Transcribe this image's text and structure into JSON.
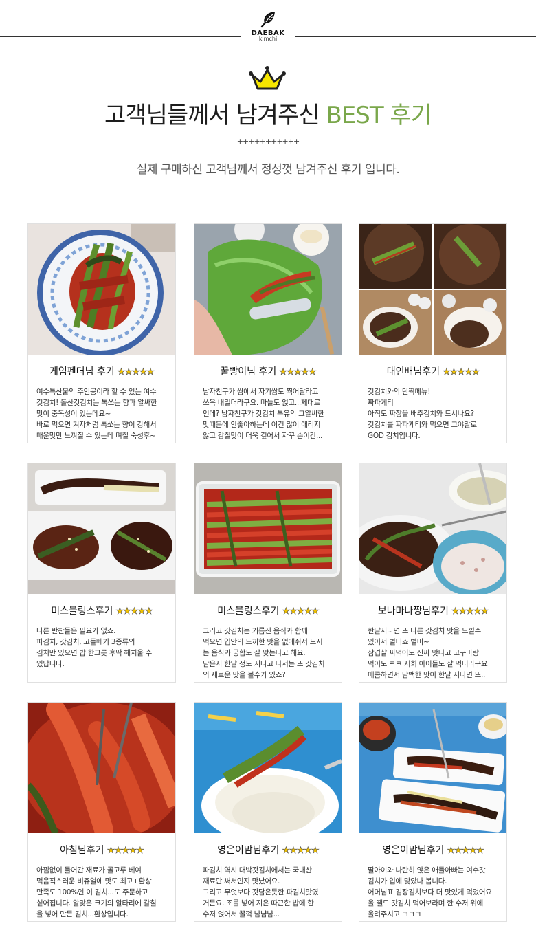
{
  "brand": {
    "name": "DAEBAK",
    "sub": "kimchi",
    "logo_icon": "leaf-icon"
  },
  "header": {
    "crown_icon": "crown-icon",
    "title_main": "고객님들께서 남겨주신 ",
    "title_accent": "BEST 후기",
    "divider": "+++++++++++",
    "subtitle": "실제 구매하신 고객님께서 정성껏 남겨주신 후기 입니다."
  },
  "colors": {
    "accent": "#7aa74b",
    "star": "#f2c200",
    "kimchi_red": "#c8301c",
    "leaf_green": "#4f8a2a"
  },
  "reviews": [
    {
      "title": "게임펜더님 후기",
      "stars": "★★★★★",
      "lines": [
        "여수특산물의 주인공이라 할 수 있는 여수",
        "갓김치! 돌산갓김치는 톡쏘는 향과 알싸한",
        "맛이 중독성이 있는데요~",
        "바로 먹으면 겨자처럼 톡쏘는 향이 강해서",
        "매운맛만 느껴질 수 있는데 며칠 숙성후~"
      ]
    },
    {
      "title": "꿀빵이님 후기",
      "stars": "★★★★★",
      "lines": [
        "남자친구가 쌈에서 자기쌈도 찍어달라고",
        "쓰윽 내밀더라구요. 마늘도 얹고...제대로",
        "인데? 남자친구가 갓김치 특유의 그알싸한",
        "맛때문에 안좋아하는데 이건 많이 애리지",
        "않고 감칠맛이 더욱 깊어서 자꾸 손이간..."
      ]
    },
    {
      "title": "대인배님후기",
      "stars": "★★★★★",
      "lines": [
        "갓김치와의 단짝메뉴!",
        "짜파게티",
        "아직도 짜장을 배추김치와 드시나요?",
        "갓김치를 짜파게티와 먹으면 그야말로",
        "GOD 김치입니다."
      ]
    },
    {
      "title": "미스블링스후기",
      "stars": "★★★★★",
      "lines": [
        "다른 반찬들은 필요가 없죠.",
        "파김치, 갓김치, 고들빼기 3종류의",
        "김치만 있으면 밥 한그릇 후딱 해치울 수",
        "있답니다."
      ]
    },
    {
      "title": "미스블링스후기",
      "stars": "★★★★★",
      "lines": [
        "그리고 갓김치는 기름진 음식과 함께",
        "먹으면 입안의 느끼한 맛을 없애줘서 드시",
        "는 음식과 궁합도 잘 맞는다고 해요.",
        "담은지 한달 정도 지나고 나서는 또 갓김치",
        "의 새로운 맛을 볼수가 있죠?"
      ]
    },
    {
      "title": "보나마나짱님후기",
      "stars": "★★★★★",
      "lines": [
        "한달지나면 또 다른 갓김치 맛을 느낄수",
        "있어서 별미죠 별미~",
        "삼겹살 싸먹어도 진짜 맛나고 고구마랑",
        "먹어도 ㅋㅋ 저희 아이들도 잘 먹더라구요",
        "매콤하면서 담백한 맛이 한달 지나면 또.."
      ]
    },
    {
      "title": "아침님후기",
      "stars": "★★★★★",
      "lines": [
        "아낌없이 들어간 재료가 골고루 베여",
        "먹음직스러운 비쥬얼에 맛도 최고+환상",
        "만족도 100%인 이 김치...도 주문하고",
        "싶어집니다. 알맞은 크기의 알타리에 갈칠",
        "을 넣어 만든 김치...환상입니다."
      ]
    },
    {
      "title": "영은이맘님후기",
      "stars": "★★★★★",
      "lines": [
        "파김치 역시 대박갓김치에서는 국내산",
        "재료만 써서인지 맛났어요.",
        "그리고 무엇보다 갓담은듯한 파김치맛였",
        "거든요. 조를 넣어 지은 따끈한 밥에 한",
        "수저 얹어서 꿀꺽 냠냠냠..."
      ]
    },
    {
      "title": "영은이맘님후기",
      "stars": "★★★★★",
      "lines": [
        "딸아이와 나란히 앉은 애들아빠는 여수갓",
        "김치가 입에 맞았나 봅니다.",
        "어머님표 김장김치보다 더 맛있게 먹었어요",
        "올 땔도 갓김치 먹어보라며 한 수저 위에",
        "올려주시고 ㅋㅋㅋ"
      ]
    }
  ]
}
